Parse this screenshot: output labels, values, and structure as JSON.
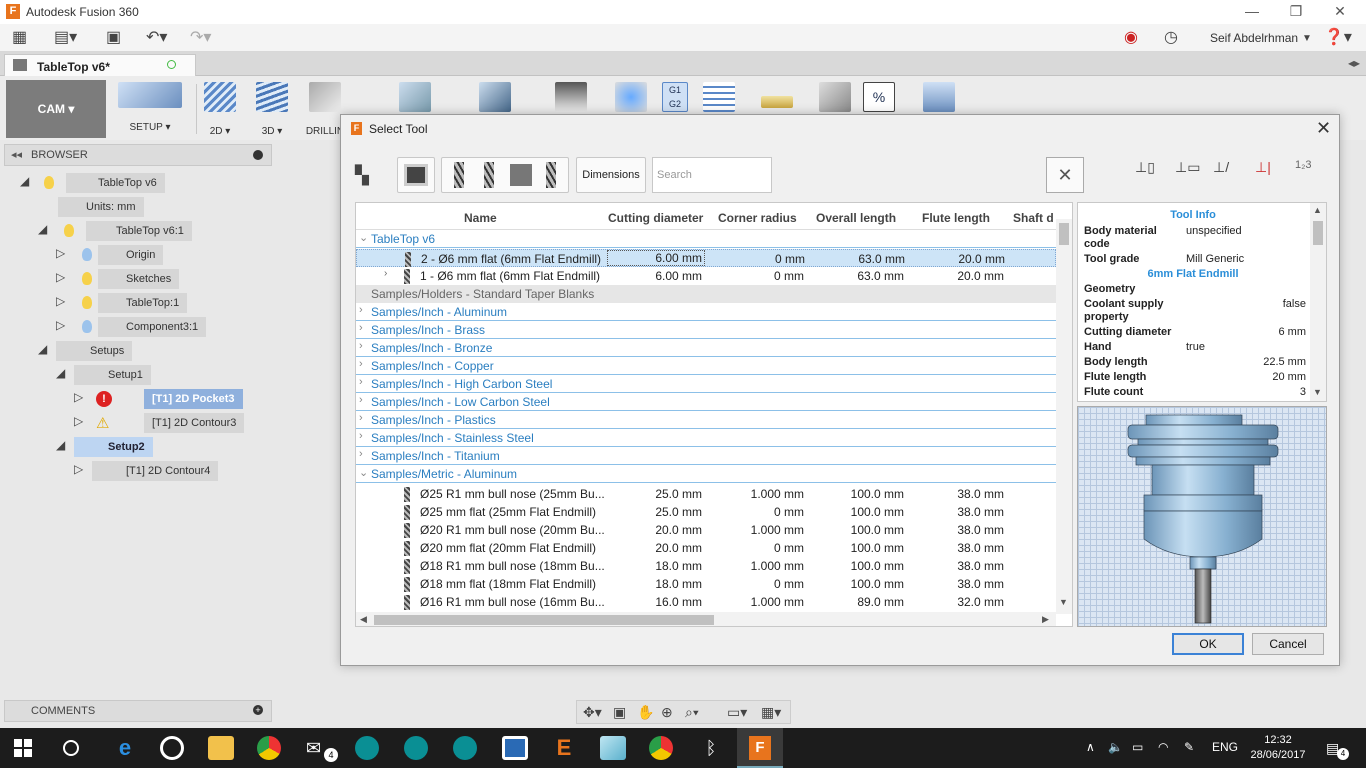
{
  "window": {
    "title": "Autodesk Fusion 360",
    "logo": "F"
  },
  "qat": {
    "user": "Seif Abdelrhman"
  },
  "doc_tab": {
    "title": "TableTop v6*"
  },
  "toolbar": {
    "workspace": "CAM",
    "groups": [
      "SETUP",
      "2D",
      "3D",
      "DRILLIN"
    ]
  },
  "browser": {
    "title": "BROWSER",
    "items": [
      {
        "label": "TableTop v6"
      },
      {
        "label": "Units: mm"
      },
      {
        "label": "TableTop v6:1"
      },
      {
        "label": "Origin"
      },
      {
        "label": "Sketches"
      },
      {
        "label": "TableTop:1"
      },
      {
        "label": "Component3:1"
      },
      {
        "label": "Setups"
      },
      {
        "label": "Setup1"
      },
      {
        "label": "[T1] 2D Pocket3"
      },
      {
        "label": "[T1] 2D Contour3"
      },
      {
        "label": "Setup2"
      },
      {
        "label": "[T1] 2D Contour4"
      }
    ]
  },
  "comments": {
    "title": "COMMENTS"
  },
  "dialog": {
    "title": "Select Tool",
    "dimensions_label": "Dimensions",
    "search_placeholder": "Search",
    "columns": [
      "Name",
      "Cutting diameter",
      "Corner radius",
      "Overall length",
      "Flute length",
      "Shaft d"
    ],
    "groups_top": [
      {
        "label": "TableTop v6"
      }
    ],
    "tools_top": [
      {
        "name": "2 - Ø6 mm flat (6mm Flat Endmill)",
        "diameter": "6.00 mm",
        "radius": "0 mm",
        "overall": "63.0 mm",
        "flute": "20.0 mm"
      },
      {
        "name": "1 - Ø6 mm flat (6mm Flat Endmill)",
        "diameter": "6.00 mm",
        "radius": "0 mm",
        "overall": "63.0 mm",
        "flute": "20.0 mm"
      }
    ],
    "library_groups": [
      "Samples/Holders - Standard Taper Blanks",
      "Samples/Inch - Aluminum",
      "Samples/Inch - Brass",
      "Samples/Inch - Bronze",
      "Samples/Inch - Copper",
      "Samples/Inch - High Carbon Steel",
      "Samples/Inch - Low Carbon Steel",
      "Samples/Inch - Plastics",
      "Samples/Inch - Stainless Steel",
      "Samples/Inch - Titanium",
      "Samples/Metric - Aluminum"
    ],
    "metric_tools": [
      {
        "name": "Ø25 R1 mm bull nose (25mm Bu...",
        "diameter": "25.0 mm",
        "radius": "1.000 mm",
        "overall": "100.0 mm",
        "flute": "38.0 mm"
      },
      {
        "name": "Ø25 mm flat (25mm Flat Endmill)",
        "diameter": "25.0 mm",
        "radius": "0 mm",
        "overall": "100.0 mm",
        "flute": "38.0 mm"
      },
      {
        "name": "Ø20 R1 mm bull nose (20mm Bu...",
        "diameter": "20.0 mm",
        "radius": "1.000 mm",
        "overall": "100.0 mm",
        "flute": "38.0 mm"
      },
      {
        "name": "Ø20 mm flat (20mm Flat Endmill)",
        "diameter": "20.0 mm",
        "radius": "0 mm",
        "overall": "100.0 mm",
        "flute": "38.0 mm"
      },
      {
        "name": "Ø18 R1 mm bull nose (18mm Bu...",
        "diameter": "18.0 mm",
        "radius": "1.000 mm",
        "overall": "100.0 mm",
        "flute": "38.0 mm"
      },
      {
        "name": "Ø18 mm flat (18mm Flat Endmill)",
        "diameter": "18.0 mm",
        "radius": "0 mm",
        "overall": "100.0 mm",
        "flute": "38.0 mm"
      },
      {
        "name": "Ø16 R1 mm bull nose (16mm Bu...",
        "diameter": "16.0 mm",
        "radius": "1.000 mm",
        "overall": "89.0 mm",
        "flute": "32.0 mm"
      }
    ],
    "tool_info": {
      "title": "Tool Info",
      "body_material_k": "Body material code",
      "body_material_v": "unspecified",
      "tool_grade_k": "Tool grade",
      "tool_grade_v": "Mill Generic",
      "tool_name": "6mm Flat Endmill",
      "geometry": "Geometry",
      "coolant_k": "Coolant supply property",
      "coolant_v": "false",
      "cutting_k": "Cutting diameter",
      "cutting_v": "6 mm",
      "hand_k": "Hand",
      "hand_v": "true",
      "body_len_k": "Body length",
      "body_len_v": "22.5 mm",
      "flute_len_k": "Flute length",
      "flute_len_v": "20 mm",
      "flute_count_k": "Flute count",
      "flute_count_v": "3"
    },
    "ok_label": "OK",
    "cancel_label": "Cancel"
  },
  "taskbar": {
    "lang": "ENG",
    "time": "12:32",
    "date": "28/06/2017",
    "notifications": "4"
  }
}
